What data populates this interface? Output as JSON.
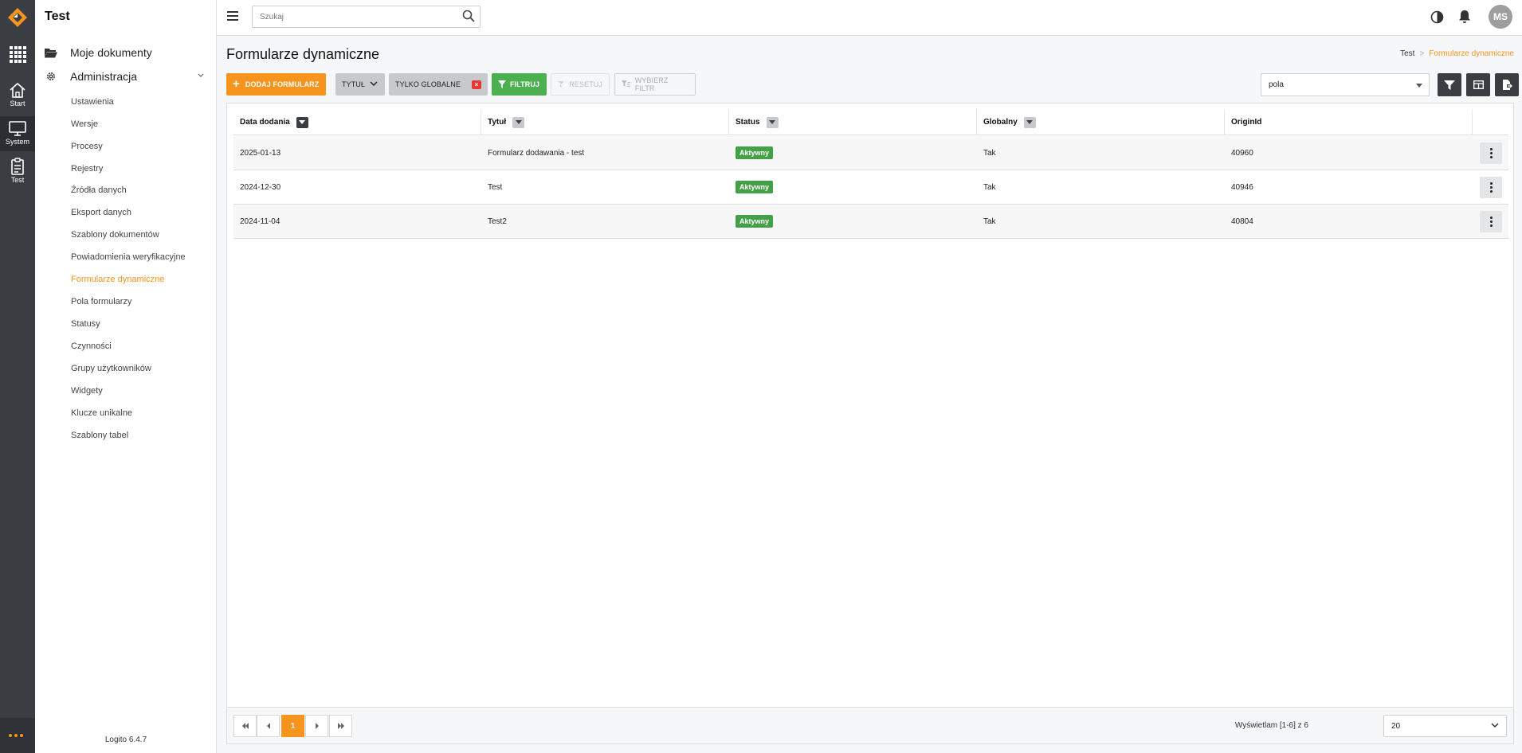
{
  "app": {
    "rail": [
      {
        "label": "Start",
        "icon": "home-icon"
      },
      {
        "label": "System",
        "icon": "monitor-icon"
      },
      {
        "label": "Test",
        "icon": "clipboard-icon"
      }
    ],
    "version": "Logito 6.4.7"
  },
  "sidebar": {
    "title": "Test",
    "sections": [
      {
        "label": "Moje dokumenty",
        "icon": "folder-open-icon"
      },
      {
        "label": "Administracja",
        "icon": "gear-icon"
      }
    ],
    "items": [
      {
        "label": "Ustawienia"
      },
      {
        "label": "Wersje"
      },
      {
        "label": "Procesy"
      },
      {
        "label": "Rejestry"
      },
      {
        "label": "Źródła danych"
      },
      {
        "label": "Eksport danych"
      },
      {
        "label": "Szablony dokumentów"
      },
      {
        "label": "Powiadomienia weryfikacyjne"
      },
      {
        "label": "Formularze dynamiczne",
        "active": true
      },
      {
        "label": "Pola formularzy"
      },
      {
        "label": "Statusy"
      },
      {
        "label": "Czynności"
      },
      {
        "label": "Grupy użytkowników"
      },
      {
        "label": "Widgety"
      },
      {
        "label": "Klucze unikalne"
      },
      {
        "label": "Szablony tabel"
      }
    ]
  },
  "topbar": {
    "search_placeholder": "Szukaj",
    "avatar_initials": "MS"
  },
  "page": {
    "title": "Formularze dynamiczne",
    "breadcrumb": [
      "Test",
      "Formularze dynamiczne"
    ]
  },
  "toolbar": {
    "add_label": "DODAJ FORMULARZ",
    "tytul_label": "TYTUŁ",
    "global_label": "TYLKO GLOBALNE",
    "filter_label": "FILTRUJ",
    "reset_label": "RESETUJ",
    "choose_filter_label": "WYBIERZ FILTR",
    "column_select_value": "pola"
  },
  "table": {
    "columns": [
      "Data dodania",
      "Tytuł",
      "Status",
      "Globalny",
      "OriginId"
    ],
    "rows": [
      {
        "date": "2025-01-13",
        "title": "Formularz dodawania - test",
        "status": "Aktywny",
        "global": "Tak",
        "origin": "40960"
      },
      {
        "date": "2024-12-30",
        "title": "Test",
        "status": "Aktywny",
        "global": "Tak",
        "origin": "40946"
      },
      {
        "date": "2024-11-04",
        "title": "Test2",
        "status": "Aktywny",
        "global": "Tak",
        "origin": "40804"
      }
    ]
  },
  "pagination": {
    "current_page": "1",
    "info": "Wyświetlam [1-6] z 6",
    "page_size": "20"
  },
  "colors": {
    "accent": "#f7941d",
    "rail": "#3a3d42",
    "success": "#43a047"
  }
}
